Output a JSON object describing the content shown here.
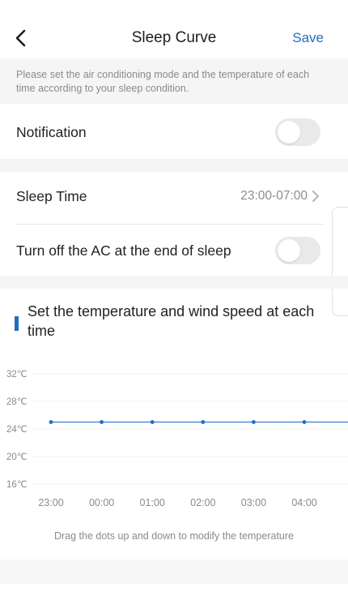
{
  "header": {
    "title": "Sleep Curve",
    "save_label": "Save"
  },
  "description": "Please set the air conditioning mode and the temperature of each time according to your sleep condition.",
  "notification": {
    "label": "Notification",
    "enabled": false
  },
  "sleep_time": {
    "label": "Sleep Time",
    "value": "23:00-07:00"
  },
  "turn_off": {
    "label": "Turn off the AC at the end of sleep",
    "enabled": false
  },
  "section": {
    "title": "Set the temperature and wind speed at each time"
  },
  "hint": "Drag the dots up and down to modify the temperature",
  "colors": {
    "accent": "#1e6fbf",
    "line": "#3a7bc8",
    "toggle_off": "#e9e9e9"
  },
  "icons": {
    "back": "chevron-left-icon",
    "forward": "chevron-right-icon"
  },
  "chart_data": {
    "type": "line",
    "x": [
      "23:00",
      "00:00",
      "01:00",
      "02:00",
      "03:00",
      "04:00"
    ],
    "series": [
      {
        "values": [
          25,
          25,
          25,
          25,
          25,
          25
        ]
      }
    ],
    "yticks": [
      "32℃",
      "28℃",
      "24℃",
      "20℃",
      "16℃"
    ],
    "ytick_values": [
      32,
      28,
      24,
      20,
      16
    ],
    "ylim": [
      16,
      32
    ],
    "grid": true
  }
}
